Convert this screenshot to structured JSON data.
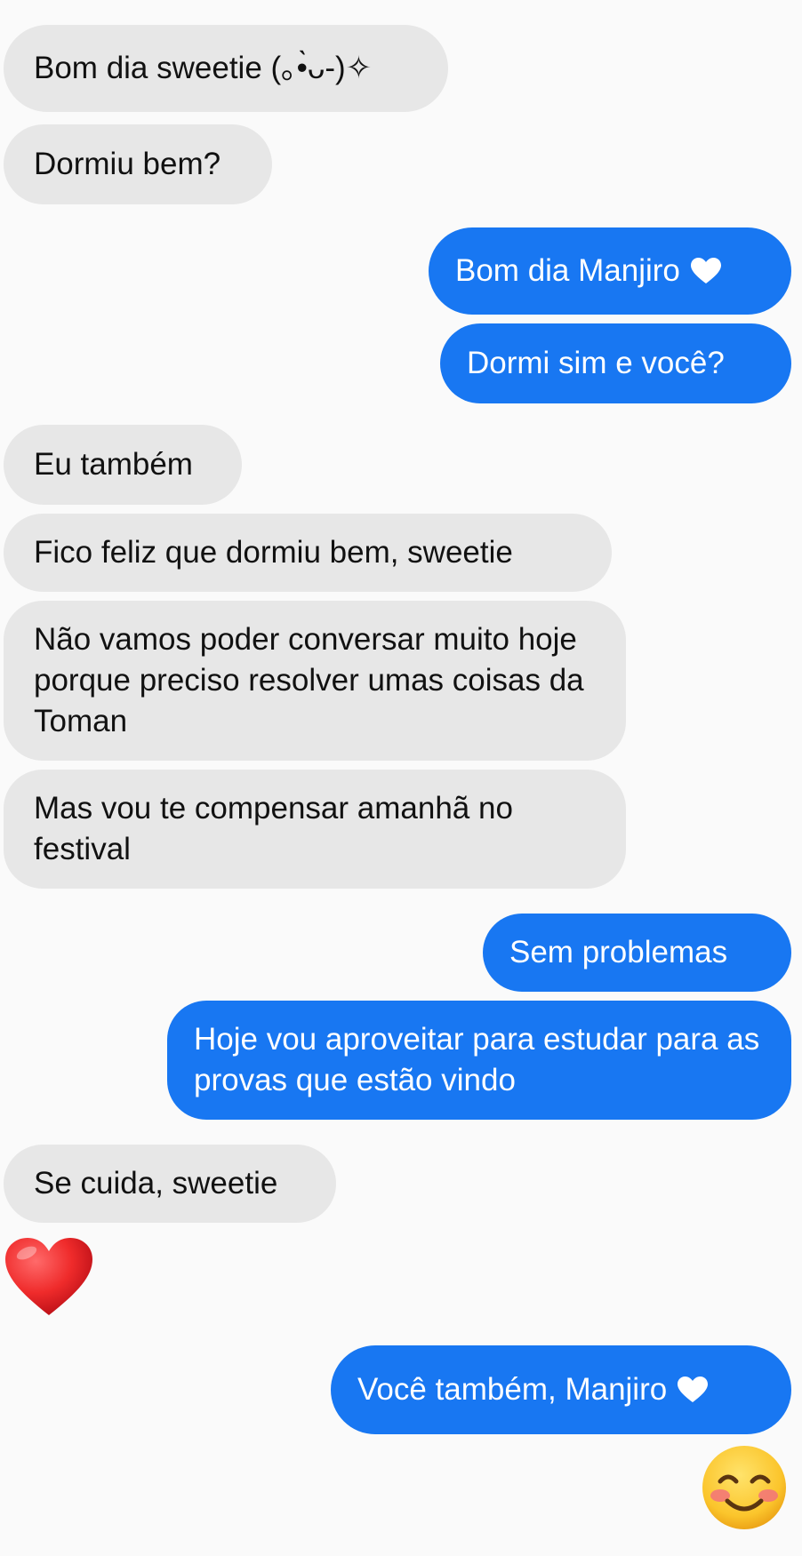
{
  "colors": {
    "incoming_bubble": "#e7e7e7",
    "outgoing_bubble": "#1877f2",
    "background": "#fafafa"
  },
  "messages": [
    {
      "direction": "in",
      "text": "Bom dia sweetie (｡•̀ᴗ-)✧"
    },
    {
      "direction": "in",
      "text": "Dormiu bem?"
    },
    {
      "direction": "out",
      "text": "Bom dia Manjiro",
      "icon": "white-heart-icon"
    },
    {
      "direction": "out",
      "text": "Dormi sim e você?"
    },
    {
      "direction": "in",
      "text": "Eu também"
    },
    {
      "direction": "in",
      "text": "Fico feliz que dormiu bem, sweetie"
    },
    {
      "direction": "in",
      "text": "Não vamos poder conversar muito hoje porque preciso resolver umas coisas da Toman"
    },
    {
      "direction": "in",
      "text": "Mas vou te compensar amanhã no festival"
    },
    {
      "direction": "out",
      "text": "Sem problemas"
    },
    {
      "direction": "out",
      "text": "Hoje vou aproveitar para estudar para as provas que estão vindo"
    },
    {
      "direction": "in",
      "text": "Se cuida, sweetie"
    },
    {
      "direction": "in",
      "emoji": "red-heart-emoji"
    },
    {
      "direction": "out",
      "text": "Você também, Manjiro",
      "icon": "white-heart-icon"
    },
    {
      "direction": "out",
      "emoji": "smiling-blush-emoji"
    }
  ]
}
